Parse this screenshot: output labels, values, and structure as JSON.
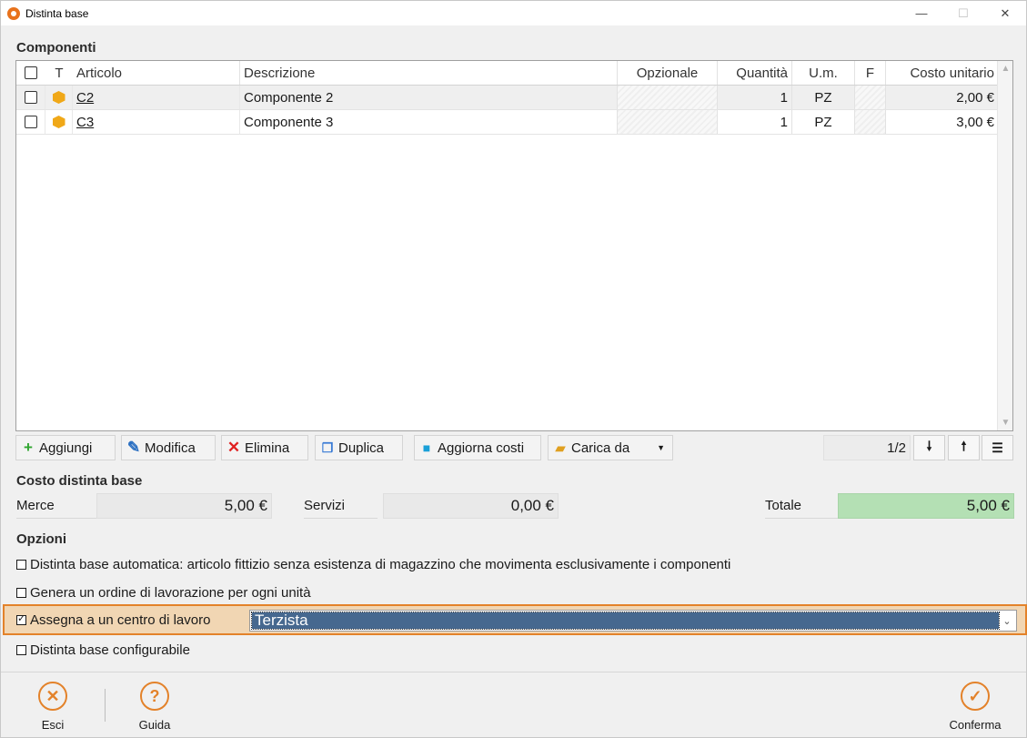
{
  "window": {
    "title": "Distinta base"
  },
  "components": {
    "section_title": "Componenti",
    "columns": [
      "T",
      "Articolo",
      "Descrizione",
      "Opzionale",
      "Quantità",
      "U.m.",
      "F",
      "Costo unitario"
    ],
    "rows": [
      {
        "articolo": "C2",
        "descrizione": "Componente 2",
        "quantita": "1",
        "um": "PZ",
        "costo": "2,00 €"
      },
      {
        "articolo": "C3",
        "descrizione": "Componente 3",
        "quantita": "1",
        "um": "PZ",
        "costo": "3,00 €"
      }
    ]
  },
  "toolbar": {
    "add": "Aggiungi",
    "edit": "Modifica",
    "delete": "Elimina",
    "duplicate": "Duplica",
    "update_costs": "Aggiorna costi",
    "load_from": "Carica da",
    "pager": "1/2"
  },
  "cost": {
    "section_title": "Costo distinta base",
    "merce_label": "Merce",
    "merce_value": "5,00 €",
    "servizi_label": "Servizi",
    "servizi_value": "0,00 €",
    "totale_label": "Totale",
    "totale_value": "5,00 €"
  },
  "options": {
    "section_title": "Opzioni",
    "automatic": "Distinta base automatica: articolo fittizio senza esistenza di magazzino che movimenta esclusivamente i componenti",
    "work_order": "Genera un ordine di lavorazione per ogni unità",
    "assign_center": "Assegna a un centro di lavoro",
    "assign_center_checked": true,
    "center_value": "Terzista",
    "configurable": "Distinta base configurabile"
  },
  "footer": {
    "exit": "Esci",
    "help": "Guida",
    "confirm": "Conferma"
  },
  "colors": {
    "accent": "#e3822a",
    "total_bg": "#b4e0b4",
    "selection": "#46688f"
  }
}
